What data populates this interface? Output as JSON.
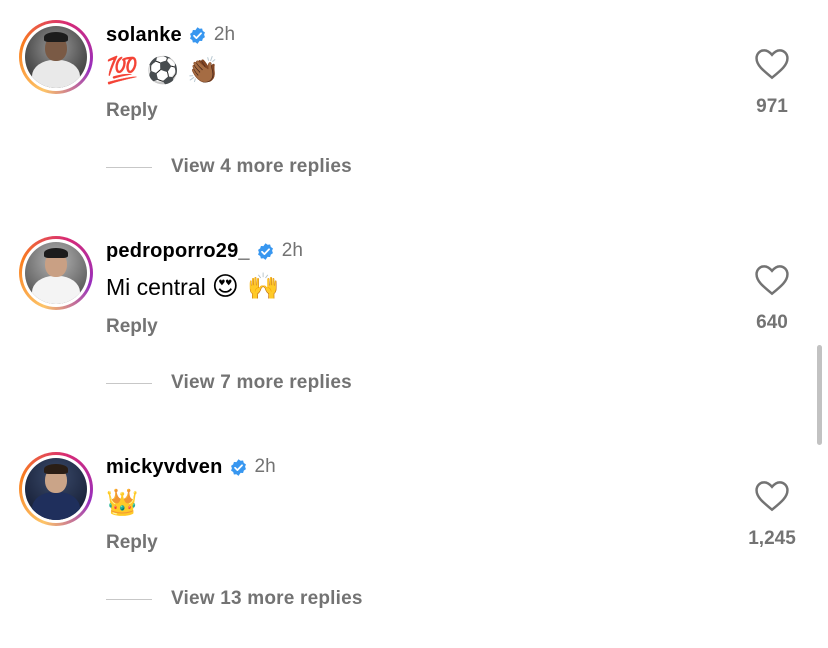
{
  "comments": [
    {
      "username": "solanke",
      "time": "2h",
      "text": "",
      "emoji": "💯 ⚽ 👏🏾",
      "reply_label": "Reply",
      "likes": "971",
      "view_replies": "View 4 more replies"
    },
    {
      "username": "pedroporro29_",
      "time": "2h",
      "text": "Mi central",
      "emoji": "😍 🙌",
      "reply_label": "Reply",
      "likes": "640",
      "view_replies": "View 7 more replies"
    },
    {
      "username": "mickyvdven",
      "time": "2h",
      "text": "",
      "emoji": "👑",
      "reply_label": "Reply",
      "likes": "1,245",
      "view_replies": "View 13 more replies"
    }
  ],
  "colors": {
    "verified": "#3897f0",
    "secondary_text": "#737373",
    "avatar_ring": "instagram-gradient"
  },
  "icons": {
    "verified": "verified-badge-icon",
    "like": "heart-outline-icon"
  }
}
